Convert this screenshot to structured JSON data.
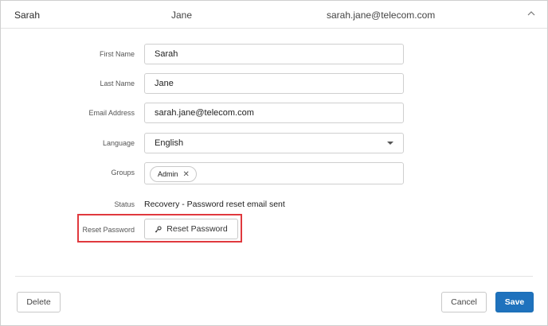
{
  "header": {
    "first_name": "Sarah",
    "last_name": "Jane",
    "email": "sarah.jane@telecom.com",
    "collapse_icon": "chevron-up-icon"
  },
  "form": {
    "first_name": {
      "label": "First Name",
      "value": "Sarah"
    },
    "last_name": {
      "label": "Last Name",
      "value": "Jane"
    },
    "email": {
      "label": "Email Address",
      "value": "sarah.jane@telecom.com"
    },
    "language": {
      "label": "Language",
      "value": "English"
    },
    "groups": {
      "label": "Groups",
      "chips": [
        {
          "label": "Admin",
          "remove_icon": "close-icon"
        }
      ]
    },
    "status": {
      "label": "Status",
      "value": "Recovery - Password reset email sent"
    },
    "reset_password": {
      "label": "Reset Password",
      "button_label": "Reset Password",
      "button_icon": "key-icon"
    }
  },
  "footer": {
    "delete_label": "Delete",
    "cancel_label": "Cancel",
    "save_label": "Save"
  },
  "colors": {
    "primary": "#1f72bd",
    "highlight": "#e0393e"
  }
}
